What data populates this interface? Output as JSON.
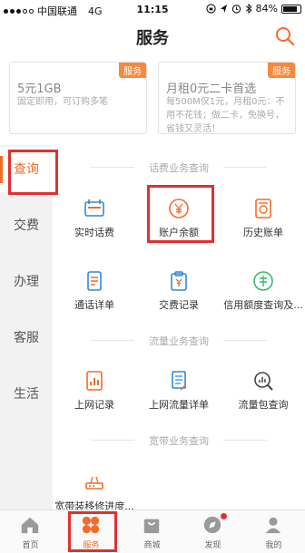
{
  "status_bar": {
    "carrier": "中国联通",
    "network": "4G",
    "time": "11:15",
    "battery": "84%",
    "battery_level": 0.84
  },
  "header": {
    "title": "服务"
  },
  "promos": [
    {
      "tag": "服务",
      "title": "5元1GB",
      "subtitle": "固定即用，可订购多笔"
    },
    {
      "tag": "服务",
      "title": "月租0元二卡首选",
      "subtitle": "每500M仅1元，月租0元：不用不花钱；做二卡，免换号，省钱又灵活！"
    }
  ],
  "sidebar": {
    "items": [
      {
        "label": "查询"
      },
      {
        "label": "交费"
      },
      {
        "label": "办理"
      },
      {
        "label": "客服"
      },
      {
        "label": "生活"
      }
    ]
  },
  "sections": [
    {
      "title": "话费业务查询",
      "items": [
        {
          "label": "实时话费",
          "icon": "wallet-icon"
        },
        {
          "label": "账户余额",
          "icon": "yen-coin-icon"
        },
        {
          "label": "历史账单",
          "icon": "bill-icon"
        },
        {
          "label": "通话详单",
          "icon": "phone-list-icon"
        },
        {
          "label": "交费记录",
          "icon": "clipboard-yen-icon"
        },
        {
          "label": "信用额度查询及...",
          "icon": "credit-icon"
        }
      ]
    },
    {
      "title": "流量业务查询",
      "items": [
        {
          "label": "上网记录",
          "icon": "usage-chart-icon"
        },
        {
          "label": "上网流量详单",
          "icon": "flow-detail-icon"
        },
        {
          "label": "流量包查询",
          "icon": "package-search-icon"
        }
      ]
    },
    {
      "title": "宽带业务查询",
      "items": [
        {
          "label": "宽带装移修进度...",
          "icon": "router-icon"
        }
      ]
    }
  ],
  "tabbar": {
    "items": [
      {
        "label": "首页",
        "icon": "home-icon"
      },
      {
        "label": "服务",
        "icon": "service-icon"
      },
      {
        "label": "商城",
        "icon": "shop-icon"
      },
      {
        "label": "发现",
        "icon": "compass-icon"
      },
      {
        "label": "我的",
        "icon": "user-icon"
      }
    ]
  },
  "colors": {
    "accent": "#f26c28",
    "blue": "#2c8ad9",
    "green": "#3cb86a",
    "highlight": "#e0312f"
  }
}
